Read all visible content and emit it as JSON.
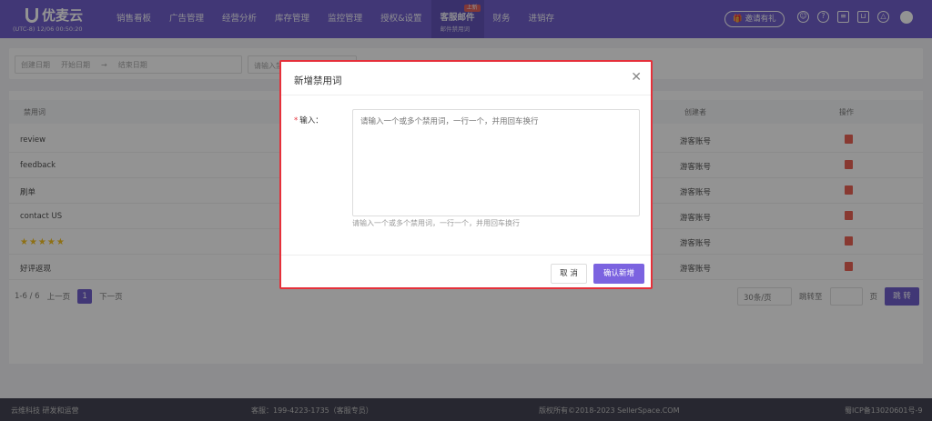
{
  "app": {
    "name": "优麦云",
    "timezone": "(UTC-8) 12/06 00:50:20"
  },
  "nav": {
    "items": [
      {
        "label": "销售看板"
      },
      {
        "label": "广告管理"
      },
      {
        "label": "经营分析"
      },
      {
        "label": "库存管理"
      },
      {
        "label": "监控管理"
      },
      {
        "label": "授权&设置"
      },
      {
        "label": "客服邮件",
        "sub": "邮件禁用词",
        "badge": "上新"
      },
      {
        "label": "财务"
      },
      {
        "label": "进销存"
      }
    ],
    "invite": "邀请有礼"
  },
  "filters": {
    "date_label": "创建日期",
    "start_placeholder": "开始日期",
    "arrow": "→",
    "end_placeholder": "结束日期",
    "keyword_placeholder": "请输入禁用词"
  },
  "table": {
    "headers": {
      "word": "禁用词",
      "creator": "创建者",
      "action": "操作"
    },
    "rows": [
      {
        "word": "review",
        "creator": "游客账号"
      },
      {
        "word": "feedback",
        "creator": "游客账号"
      },
      {
        "word": "刷单",
        "creator": "游客账号"
      },
      {
        "word": "contact US",
        "creator": "游客账号"
      },
      {
        "word": "★★★★★",
        "creator": "游客账号"
      },
      {
        "word": "好评返现",
        "creator": "游客账号"
      }
    ]
  },
  "pager": {
    "info": "1-6 / 6",
    "prev": "上一页",
    "page": "1",
    "next": "下一页",
    "per_page": "30条/页",
    "jump_label": "跳转至",
    "page_unit": "页",
    "go": "跳 转"
  },
  "footer": {
    "left": "云维科技 研发和运营",
    "phone": "客服：199-4223-1735（客服专员）",
    "copyright": "版权所有©2018-2023 SellerSpace.COM",
    "icp": "蜀ICP备13020601号-9"
  },
  "modal": {
    "title": "新增禁用词",
    "label": "输入：",
    "required": "*",
    "placeholder": "请输入一个或多个禁用词，一行一个，并用回车换行",
    "hint": "请输入一个或多个禁用词，一行一个，并用回车换行",
    "cancel": "取 消",
    "confirm": "确认新增"
  },
  "colors": {
    "brand": "#5b47c4",
    "confirm": "#7b63e0",
    "highlight_border": "#e5303a"
  }
}
